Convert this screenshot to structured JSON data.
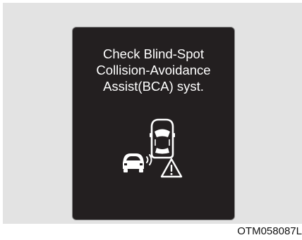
{
  "warning": {
    "line1": "Check Blind-Spot",
    "line2": "Collision-Avoidance",
    "line3": "Assist(BCA) syst."
  },
  "caption": {
    "code": "OTM058087L"
  },
  "icons": {
    "illustration": [
      "own-car-icon",
      "adjacent-car-icon",
      "radar-waves-icon",
      "warning-triangle-icon"
    ]
  },
  "colors": {
    "panel_background": "#231f20",
    "panel_border": "#8a8a8a",
    "text": "#ffffff",
    "page_background": "#e3e3e3"
  }
}
